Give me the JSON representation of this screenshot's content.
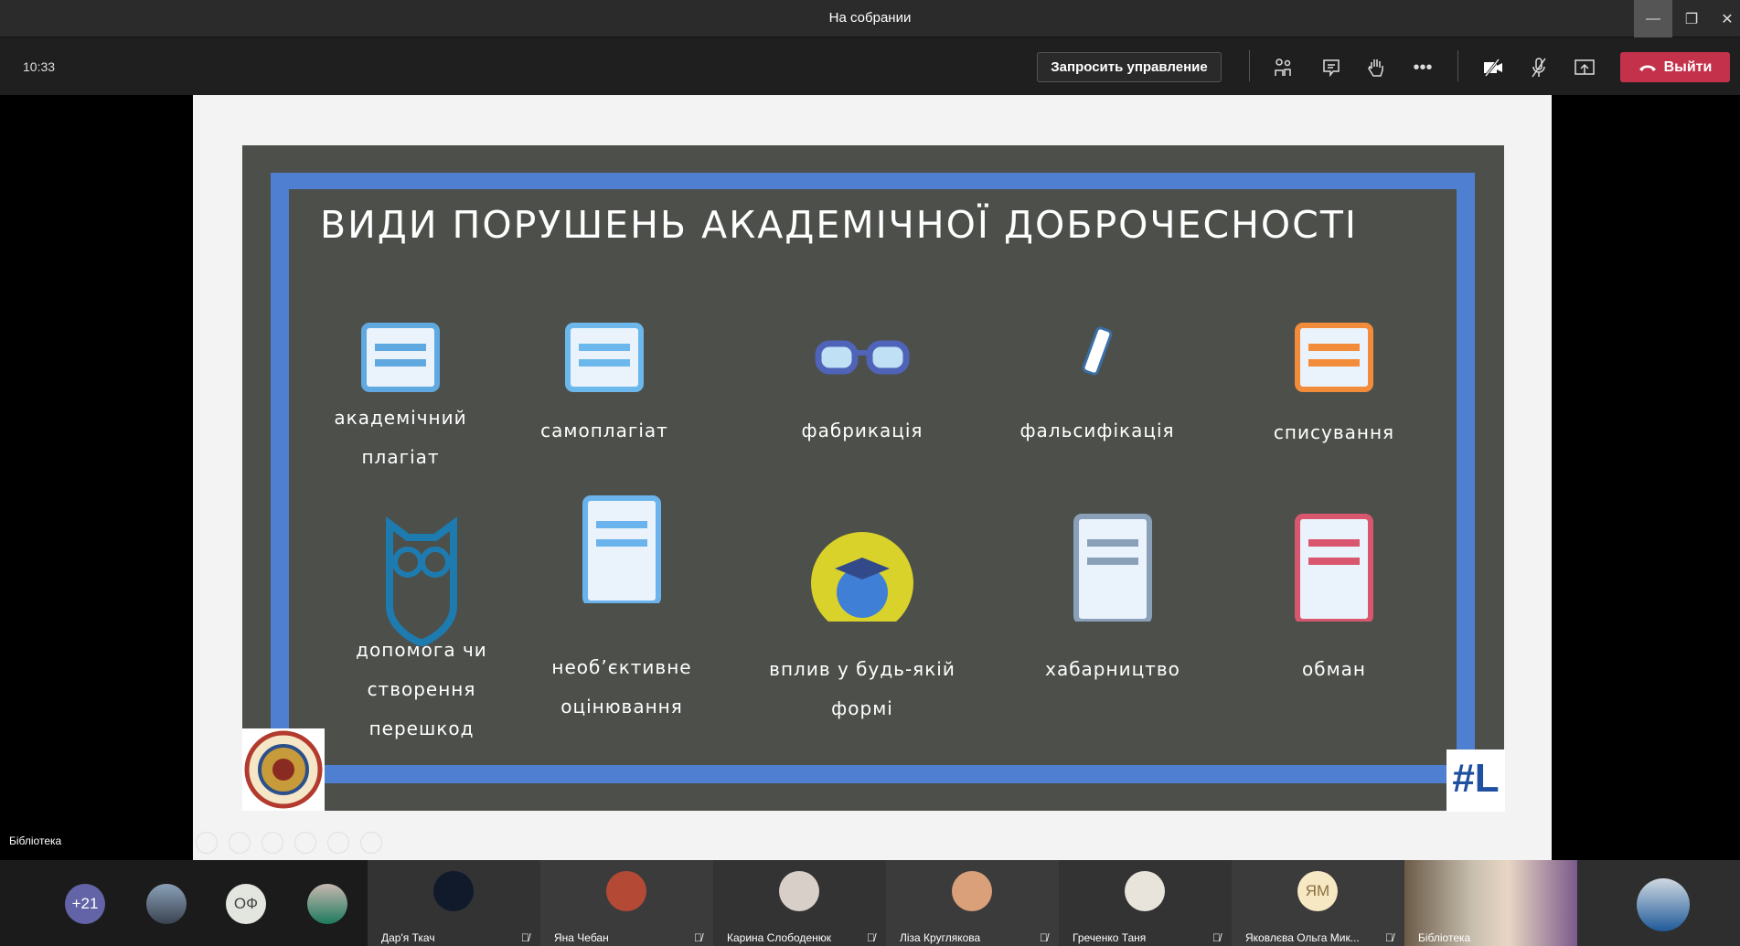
{
  "window": {
    "title": "На собрании",
    "minimize": "—",
    "restore": "❐",
    "close": "✕"
  },
  "toolbar": {
    "time": "10:33",
    "request_control": "Запросить управление",
    "more": "•••",
    "leave": "Выйти"
  },
  "slide": {
    "title": "ВИДИ ПОРУШЕНЬ АКАДЕМІЧНОЇ ДОБРОЧЕСНОСТІ",
    "items": [
      {
        "lines": [
          "академічний",
          "плагіат"
        ],
        "icon": "books-graduation-cap-icon"
      },
      {
        "lines": [
          "самоплагіат"
        ],
        "icon": "book-arrows-icon"
      },
      {
        "lines": [
          "фабрикація"
        ],
        "icon": "glasses-icon"
      },
      {
        "lines": [
          "фальсифікація"
        ],
        "icon": "pencil-icon"
      },
      {
        "lines": [
          "списування"
        ],
        "icon": "notes-papers-icon"
      },
      {
        "lines": [
          "допомога чи",
          "створення",
          "перешкод"
        ],
        "icon": "owl-icon"
      },
      {
        "lines": [
          "необ’єктивне",
          "оцінювання"
        ],
        "icon": "certificate-icon"
      },
      {
        "lines": [
          "вплив у будь-якій",
          "формі"
        ],
        "icon": "globe-cap-icon"
      },
      {
        "lines": [
          "хабарництво"
        ],
        "icon": "teacher-board-icon"
      },
      {
        "lines": [
          "обман"
        ],
        "icon": "graduate-woman-icon"
      }
    ],
    "logo_right": "#L"
  },
  "presenter_label": "Бібліотека",
  "participants": {
    "overflow": "+21",
    "avatars": [
      {
        "initials": ""
      },
      {
        "initials": "ОФ"
      },
      {
        "initials": ""
      }
    ],
    "tiles": [
      {
        "name": "Дар'я Ткач",
        "initials": ""
      },
      {
        "name": "Яна Чебан",
        "initials": ""
      },
      {
        "name": "Карина Слободенюк",
        "initials": ""
      },
      {
        "name": "Ліза Круглякова",
        "initials": ""
      },
      {
        "name": "Греченко Таня",
        "initials": ""
      },
      {
        "name": "Яковлєва Ольга Мик...",
        "initials": "ЯМ"
      },
      {
        "name": "Бібліотека",
        "initials": ""
      }
    ]
  },
  "colors": {
    "leave": "#c4314b",
    "frame": "#4f7fd1",
    "slide_bg": "#4c4f4a"
  }
}
